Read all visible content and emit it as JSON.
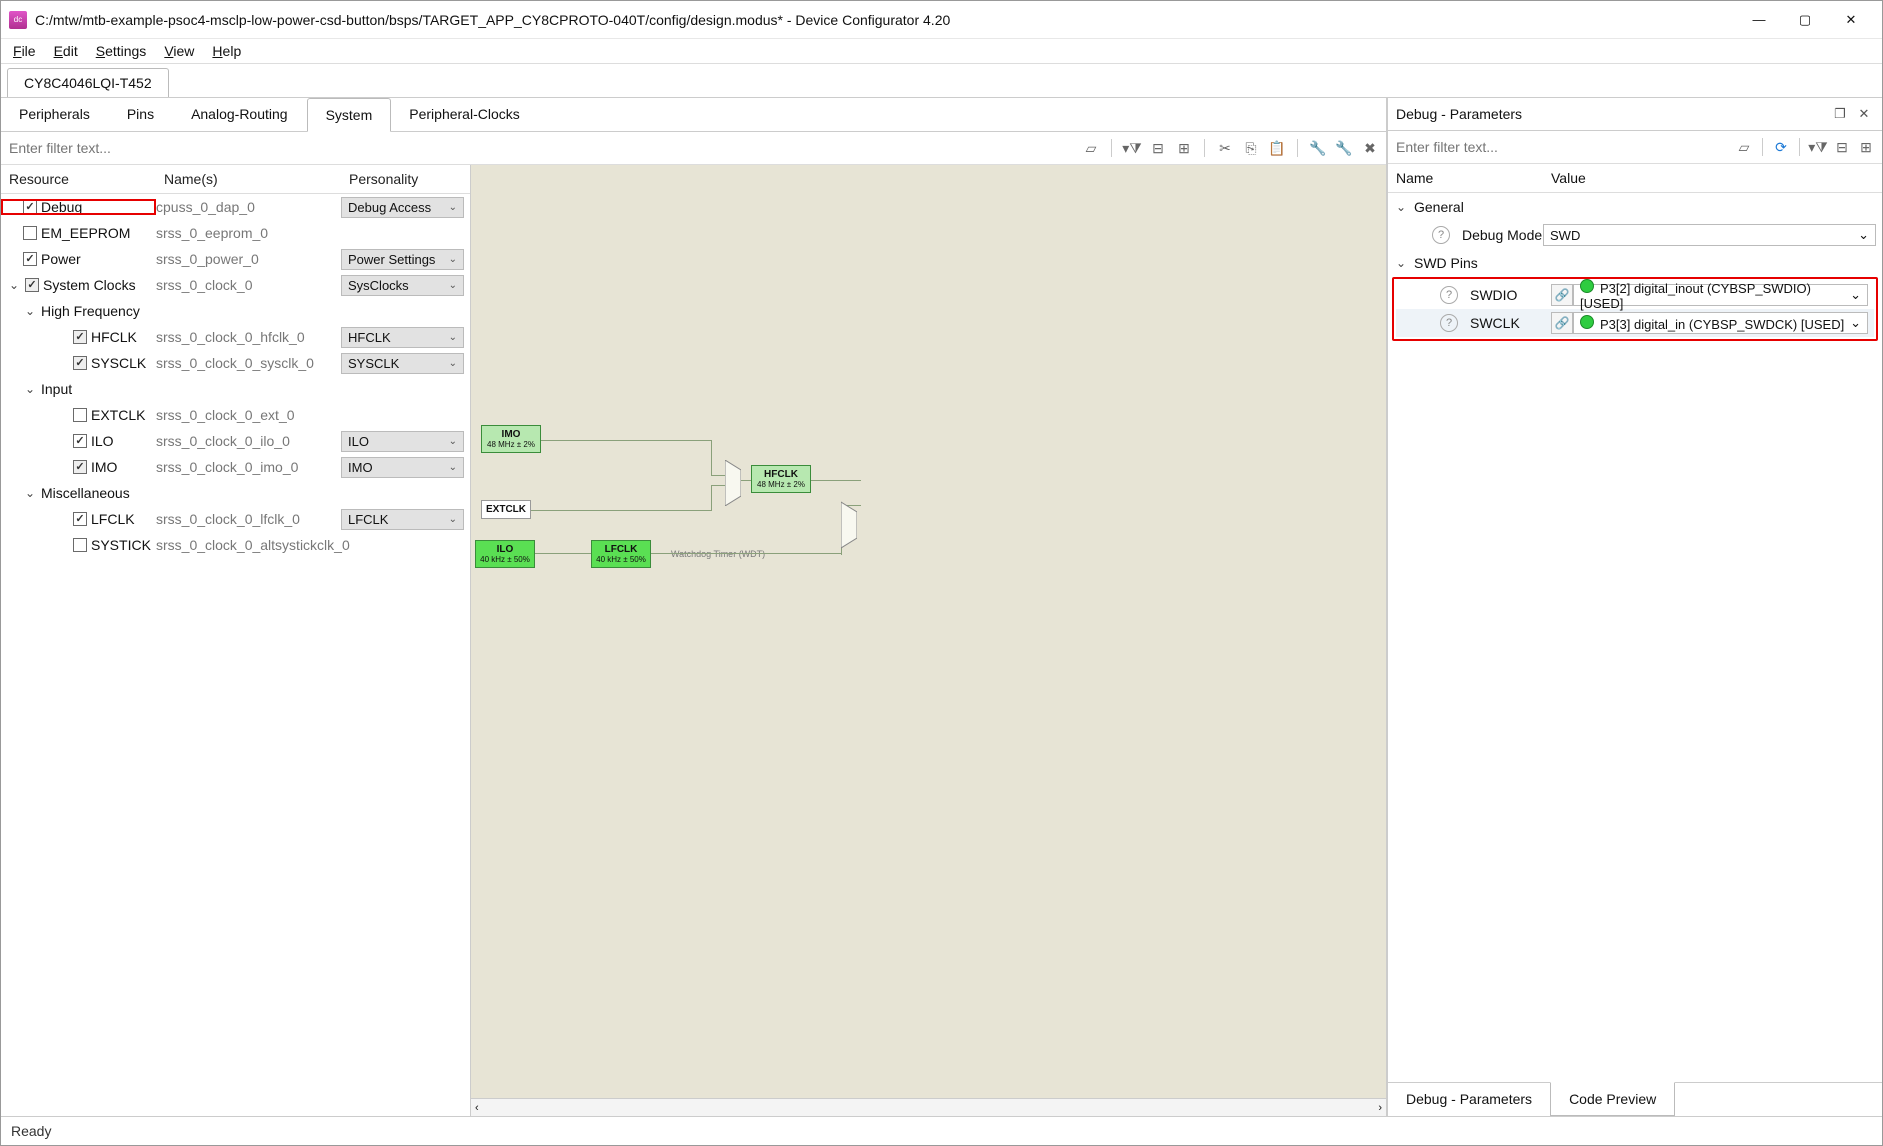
{
  "window": {
    "title": "C:/mtw/mtb-example-psoc4-msclp-low-power-csd-button/bsps/TARGET_APP_CY8CPROTO-040T/config/design.modus* - Device Configurator 4.20"
  },
  "menu": {
    "file": "File",
    "edit": "Edit",
    "settings": "Settings",
    "view": "View",
    "help": "Help"
  },
  "device_tab": "CY8C4046LQI-T452",
  "main_tabs": {
    "peripherals": "Peripherals",
    "pins": "Pins",
    "analog": "Analog-Routing",
    "system": "System",
    "pclocks": "Peripheral-Clocks"
  },
  "filter_placeholder": "Enter filter text...",
  "tree_headers": {
    "resource": "Resource",
    "names": "Name(s)",
    "personality": "Personality"
  },
  "tree": {
    "debug": {
      "label": "Debug",
      "name": "cpuss_0_dap_0",
      "pers": "Debug Access"
    },
    "eeprom": {
      "label": "EM_EEPROM",
      "name": "srss_0_eeprom_0"
    },
    "power": {
      "label": "Power",
      "name": "srss_0_power_0",
      "pers": "Power Settings"
    },
    "sysclk": {
      "label": "System Clocks",
      "name": "srss_0_clock_0",
      "pers": "SysClocks"
    },
    "hf": {
      "label": "High Frequency"
    },
    "hfclk": {
      "label": "HFCLK",
      "name": "srss_0_clock_0_hfclk_0",
      "pers": "HFCLK"
    },
    "sysclk2": {
      "label": "SYSCLK",
      "name": "srss_0_clock_0_sysclk_0",
      "pers": "SYSCLK"
    },
    "input": {
      "label": "Input"
    },
    "extclk": {
      "label": "EXTCLK",
      "name": "srss_0_clock_0_ext_0"
    },
    "ilo": {
      "label": "ILO",
      "name": "srss_0_clock_0_ilo_0",
      "pers": "ILO"
    },
    "imo": {
      "label": "IMO",
      "name": "srss_0_clock_0_imo_0",
      "pers": "IMO"
    },
    "misc": {
      "label": "Miscellaneous"
    },
    "lfclk": {
      "label": "LFCLK",
      "name": "srss_0_clock_0_lfclk_0",
      "pers": "LFCLK"
    },
    "systick": {
      "label": "SYSTICK",
      "name": "srss_0_clock_0_altsystickclk_0"
    }
  },
  "diagram": {
    "imo": {
      "t": "IMO",
      "s": "48 MHz ± 2%"
    },
    "extclk": {
      "t": "EXTCLK"
    },
    "hfclk": {
      "t": "HFCLK",
      "s": "48 MHz ± 2%"
    },
    "ilo": {
      "t": "ILO",
      "s": "40 kHz ± 50%"
    },
    "lfclk": {
      "t": "LFCLK",
      "s": "40 kHz ± 50%"
    },
    "wdt": "Watchdog Timer (WDT)"
  },
  "params": {
    "title": "Debug - Parameters",
    "filter_placeholder": "Enter filter text...",
    "headers": {
      "name": "Name",
      "value": "Value"
    },
    "general": {
      "label": "General",
      "debug_mode_label": "Debug Mode",
      "debug_mode_value": "SWD"
    },
    "swd": {
      "label": "SWD Pins",
      "swdio": {
        "label": "SWDIO",
        "value": "P3[2] digital_inout (CYBSP_SWDIO) [USED]"
      },
      "swclk": {
        "label": "SWCLK",
        "value": "P3[3] digital_in (CYBSP_SWDCK) [USED]"
      }
    }
  },
  "bottom_tabs": {
    "params": "Debug - Parameters",
    "code": "Code Preview"
  },
  "status": "Ready"
}
